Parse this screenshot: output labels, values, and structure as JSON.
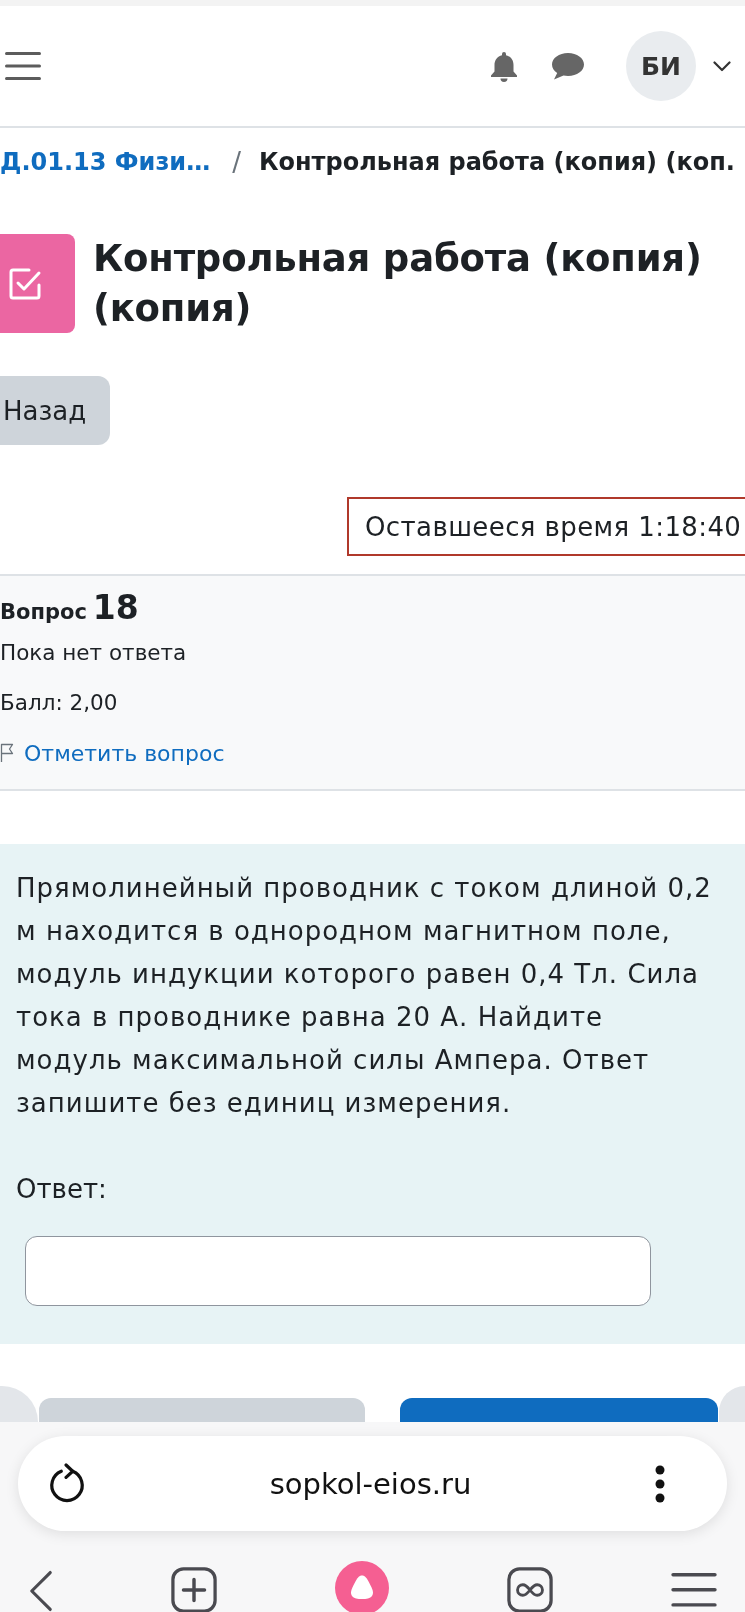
{
  "header": {
    "avatar_initials": "БИ"
  },
  "breadcrumb": {
    "separator": "/",
    "items": [
      {
        "label": "Д.01.13 Физи…",
        "link": true
      },
      {
        "label": "Контрольная работа (копия) (коп.",
        "link": false
      }
    ]
  },
  "page_title": "Контрольная работа (копия) (копия)",
  "back_button": "Назад",
  "timer": "Оставшееся время 1:18:40",
  "question_info": {
    "label": "Вопрос",
    "number": "18",
    "status": "Пока нет ответа",
    "grade": "Балл: 2,00",
    "flag": {
      "label": "Отметить вопрос",
      "flagged": false
    }
  },
  "question": {
    "text": "Прямолинейный проводник с током длиной 0,2 м находится в однородном магнитном поле, модуль индукции которого равен 0,4 Тл. Сила тока в проводнике равна 20 А. Найдите модуль максимальной силы Ампера. Ответ запишите без единиц измерения.",
    "answer_label": "Ответ:"
  },
  "nav_buttons": [
    {
      "kind": "secondary"
    },
    {
      "kind": "primary"
    }
  ],
  "browser": {
    "url": "sopkol-eios.ru"
  }
}
